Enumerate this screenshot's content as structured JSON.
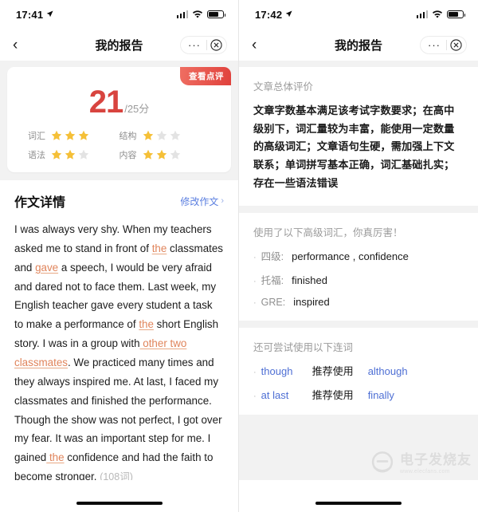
{
  "left": {
    "statusbar": {
      "time": "17:41",
      "location_icon": "location-arrow-icon",
      "signal_icon": "signal-bars-icon",
      "wifi_icon": "wifi-icon",
      "battery_icon": "battery-icon"
    },
    "nav": {
      "back_icon": "chevron-left-icon",
      "title": "我的报告",
      "more_label": "···",
      "close_icon": "close-circle-icon"
    },
    "score_card": {
      "badge_label": "查看点评",
      "score": "21",
      "total": "/25分",
      "ratings": [
        {
          "label": "词汇",
          "filled": 3,
          "max": 3
        },
        {
          "label": "结构",
          "filled": 1,
          "max": 3
        },
        {
          "label": "语法",
          "filled": 2,
          "max": 3
        },
        {
          "label": "内容",
          "filled": 2,
          "max": 3
        }
      ]
    },
    "essay": {
      "title": "作文详情",
      "edit_label": "修改作文",
      "edit_chevron": "chevron-right-icon",
      "segments": [
        {
          "text": "I was always very shy. When my teachers asked me to stand in front of ",
          "highlight": false
        },
        {
          "text": "the",
          "highlight": true
        },
        {
          "text": " classmates and ",
          "highlight": false
        },
        {
          "text": "gave",
          "highlight": true
        },
        {
          "text": " a speech, I would be very afraid and dared not to face them. Last week, my English teacher gave every student a task to make a performance of ",
          "highlight": false
        },
        {
          "text": "the",
          "highlight": true
        },
        {
          "text": " short English story. I was in a group with",
          "highlight": false
        },
        {
          "text": " other two classmates",
          "highlight": true
        },
        {
          "text": ". We practiced many times and they always inspired me. At last, I faced my classmates and finished the performance. Though the show was not perfect, I got over my fear. It was an important step for me. I gained",
          "highlight": false
        },
        {
          "text": " the",
          "highlight": true
        },
        {
          "text": " confidence and had the faith to become stronger. ",
          "highlight": false
        }
      ],
      "word_count": "(108词)"
    }
  },
  "right": {
    "statusbar": {
      "time": "17:42",
      "location_icon": "location-arrow-icon",
      "signal_icon": "signal-bars-icon",
      "wifi_icon": "wifi-icon",
      "battery_icon": "battery-icon"
    },
    "nav": {
      "back_icon": "chevron-left-icon",
      "title": "我的报告",
      "more_label": "···",
      "close_icon": "close-circle-icon"
    },
    "overall": {
      "label": "文章总体评价",
      "text": "文章字数基本满足该考试字数要求；在高中级别下，词汇量较为丰富，能使用一定数量的高级词汇；文章语句生硬，需加强上下文联系；单词拼写基本正确，词汇基础扎实；存在一些语法错误"
    },
    "vocabulary": {
      "label": "使用了以下高级词汇，你真厉害！",
      "items": [
        {
          "level": "四级:",
          "words": "performance , confidence"
        },
        {
          "level": "托福:",
          "words": "finished"
        },
        {
          "level": "GRE:",
          "words": "inspired"
        }
      ]
    },
    "conjunctions": {
      "label": "还可尝试使用以下连词",
      "items": [
        {
          "from": "though",
          "middle": "推荐使用",
          "to": "although"
        },
        {
          "from": "at last",
          "middle": "推荐使用",
          "to": "finally"
        }
      ]
    }
  },
  "watermark": {
    "cn": "电子发烧友",
    "url": "www.elecfans.com"
  },
  "colors": {
    "accent_red": "#d8443f",
    "badge_red": "#e0413c",
    "star_gold": "#f5c038",
    "star_gray": "#e3e3e3",
    "link_blue": "#5b7fe0",
    "highlight_orange": "#e0845b",
    "page_bg": "#f2f2f2"
  }
}
